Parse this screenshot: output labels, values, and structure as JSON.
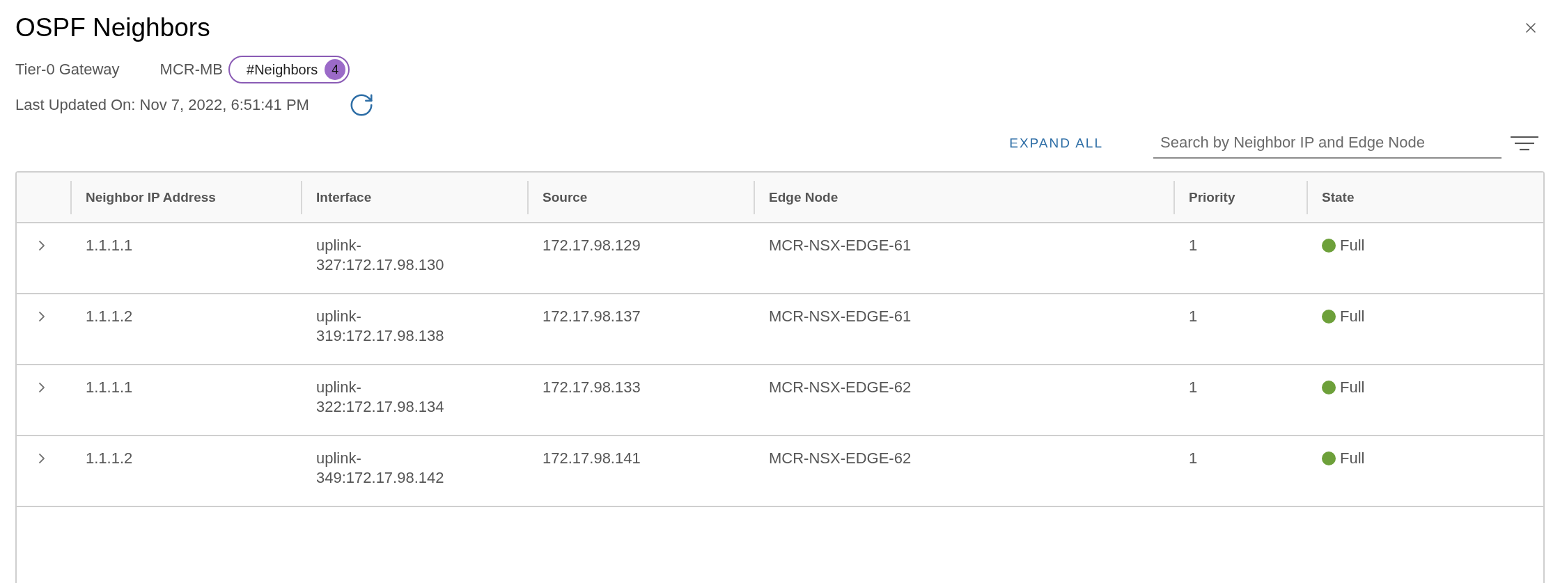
{
  "title": "OSPF Neighbors",
  "gateway": {
    "label": "Tier-0 Gateway",
    "name": "MCR-MB",
    "badge": {
      "label": "#Neighbors",
      "count": "4"
    }
  },
  "last_updated": "Last Updated On: Nov 7, 2022, 6:51:41 PM",
  "toolbar": {
    "expand_all": "EXPAND ALL",
    "search": {
      "placeholder": "Search by Neighbor IP and Edge Node"
    }
  },
  "table": {
    "columns": [
      "Neighbor IP Address",
      "Interface",
      "Source",
      "Edge Node",
      "Priority",
      "State"
    ],
    "rows": [
      {
        "expanded": false,
        "neighbor_ip": "1.1.1.1",
        "interface": "uplink-327:172.17.98.130",
        "source": "172.17.98.129",
        "edge_node": "MCR-NSX-EDGE-61",
        "priority": "1",
        "state": "Full",
        "color": "#6da03a"
      },
      {
        "expanded": false,
        "neighbor_ip": "1.1.1.2",
        "interface": "uplink-319:172.17.98.138",
        "source": "172.17.98.137",
        "edge_node": "MCR-NSX-EDGE-61",
        "priority": "1",
        "state": "Full",
        "color": "#6da03a"
      },
      {
        "expanded": false,
        "neighbor_ip": "1.1.1.1",
        "interface": "uplink-322:172.17.98.134",
        "source": "172.17.98.133",
        "edge_node": "MCR-NSX-EDGE-62",
        "priority": "1",
        "state": "Full",
        "color": "#6da03a"
      },
      {
        "expanded": false,
        "neighbor_ip": "1.1.1.2",
        "interface": "uplink-349:172.17.98.142",
        "source": "172.17.98.141",
        "edge_node": "MCR-NSX-EDGE-62",
        "priority": "1",
        "state": "Full",
        "color": "#6da03a"
      }
    ]
  }
}
